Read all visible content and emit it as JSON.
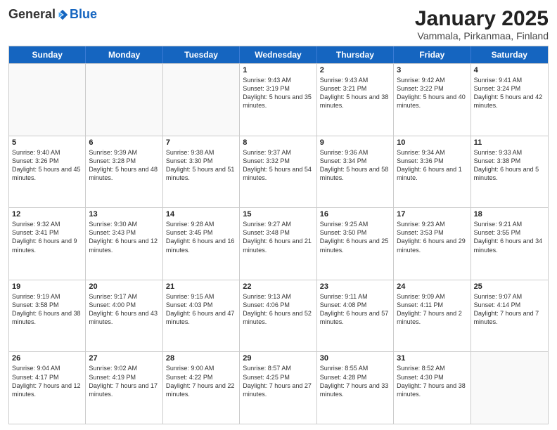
{
  "header": {
    "logo_general": "General",
    "logo_blue": "Blue",
    "month_title": "January 2025",
    "subtitle": "Vammala, Pirkanmaa, Finland"
  },
  "calendar": {
    "days_of_week": [
      "Sunday",
      "Monday",
      "Tuesday",
      "Wednesday",
      "Thursday",
      "Friday",
      "Saturday"
    ],
    "weeks": [
      [
        {
          "day": "",
          "info": "",
          "empty": true
        },
        {
          "day": "",
          "info": "",
          "empty": true
        },
        {
          "day": "",
          "info": "",
          "empty": true
        },
        {
          "day": "1",
          "info": "Sunrise: 9:43 AM\nSunset: 3:19 PM\nDaylight: 5 hours and 35 minutes."
        },
        {
          "day": "2",
          "info": "Sunrise: 9:43 AM\nSunset: 3:21 PM\nDaylight: 5 hours and 38 minutes."
        },
        {
          "day": "3",
          "info": "Sunrise: 9:42 AM\nSunset: 3:22 PM\nDaylight: 5 hours and 40 minutes."
        },
        {
          "day": "4",
          "info": "Sunrise: 9:41 AM\nSunset: 3:24 PM\nDaylight: 5 hours and 42 minutes."
        }
      ],
      [
        {
          "day": "5",
          "info": "Sunrise: 9:40 AM\nSunset: 3:26 PM\nDaylight: 5 hours and 45 minutes."
        },
        {
          "day": "6",
          "info": "Sunrise: 9:39 AM\nSunset: 3:28 PM\nDaylight: 5 hours and 48 minutes."
        },
        {
          "day": "7",
          "info": "Sunrise: 9:38 AM\nSunset: 3:30 PM\nDaylight: 5 hours and 51 minutes."
        },
        {
          "day": "8",
          "info": "Sunrise: 9:37 AM\nSunset: 3:32 PM\nDaylight: 5 hours and 54 minutes."
        },
        {
          "day": "9",
          "info": "Sunrise: 9:36 AM\nSunset: 3:34 PM\nDaylight: 5 hours and 58 minutes."
        },
        {
          "day": "10",
          "info": "Sunrise: 9:34 AM\nSunset: 3:36 PM\nDaylight: 6 hours and 1 minute."
        },
        {
          "day": "11",
          "info": "Sunrise: 9:33 AM\nSunset: 3:38 PM\nDaylight: 6 hours and 5 minutes."
        }
      ],
      [
        {
          "day": "12",
          "info": "Sunrise: 9:32 AM\nSunset: 3:41 PM\nDaylight: 6 hours and 9 minutes."
        },
        {
          "day": "13",
          "info": "Sunrise: 9:30 AM\nSunset: 3:43 PM\nDaylight: 6 hours and 12 minutes."
        },
        {
          "day": "14",
          "info": "Sunrise: 9:28 AM\nSunset: 3:45 PM\nDaylight: 6 hours and 16 minutes."
        },
        {
          "day": "15",
          "info": "Sunrise: 9:27 AM\nSunset: 3:48 PM\nDaylight: 6 hours and 21 minutes."
        },
        {
          "day": "16",
          "info": "Sunrise: 9:25 AM\nSunset: 3:50 PM\nDaylight: 6 hours and 25 minutes."
        },
        {
          "day": "17",
          "info": "Sunrise: 9:23 AM\nSunset: 3:53 PM\nDaylight: 6 hours and 29 minutes."
        },
        {
          "day": "18",
          "info": "Sunrise: 9:21 AM\nSunset: 3:55 PM\nDaylight: 6 hours and 34 minutes."
        }
      ],
      [
        {
          "day": "19",
          "info": "Sunrise: 9:19 AM\nSunset: 3:58 PM\nDaylight: 6 hours and 38 minutes."
        },
        {
          "day": "20",
          "info": "Sunrise: 9:17 AM\nSunset: 4:00 PM\nDaylight: 6 hours and 43 minutes."
        },
        {
          "day": "21",
          "info": "Sunrise: 9:15 AM\nSunset: 4:03 PM\nDaylight: 6 hours and 47 minutes."
        },
        {
          "day": "22",
          "info": "Sunrise: 9:13 AM\nSunset: 4:06 PM\nDaylight: 6 hours and 52 minutes."
        },
        {
          "day": "23",
          "info": "Sunrise: 9:11 AM\nSunset: 4:08 PM\nDaylight: 6 hours and 57 minutes."
        },
        {
          "day": "24",
          "info": "Sunrise: 9:09 AM\nSunset: 4:11 PM\nDaylight: 7 hours and 2 minutes."
        },
        {
          "day": "25",
          "info": "Sunrise: 9:07 AM\nSunset: 4:14 PM\nDaylight: 7 hours and 7 minutes."
        }
      ],
      [
        {
          "day": "26",
          "info": "Sunrise: 9:04 AM\nSunset: 4:17 PM\nDaylight: 7 hours and 12 minutes."
        },
        {
          "day": "27",
          "info": "Sunrise: 9:02 AM\nSunset: 4:19 PM\nDaylight: 7 hours and 17 minutes."
        },
        {
          "day": "28",
          "info": "Sunrise: 9:00 AM\nSunset: 4:22 PM\nDaylight: 7 hours and 22 minutes."
        },
        {
          "day": "29",
          "info": "Sunrise: 8:57 AM\nSunset: 4:25 PM\nDaylight: 7 hours and 27 minutes."
        },
        {
          "day": "30",
          "info": "Sunrise: 8:55 AM\nSunset: 4:28 PM\nDaylight: 7 hours and 33 minutes."
        },
        {
          "day": "31",
          "info": "Sunrise: 8:52 AM\nSunset: 4:30 PM\nDaylight: 7 hours and 38 minutes."
        },
        {
          "day": "",
          "info": "",
          "empty": true
        }
      ]
    ]
  }
}
